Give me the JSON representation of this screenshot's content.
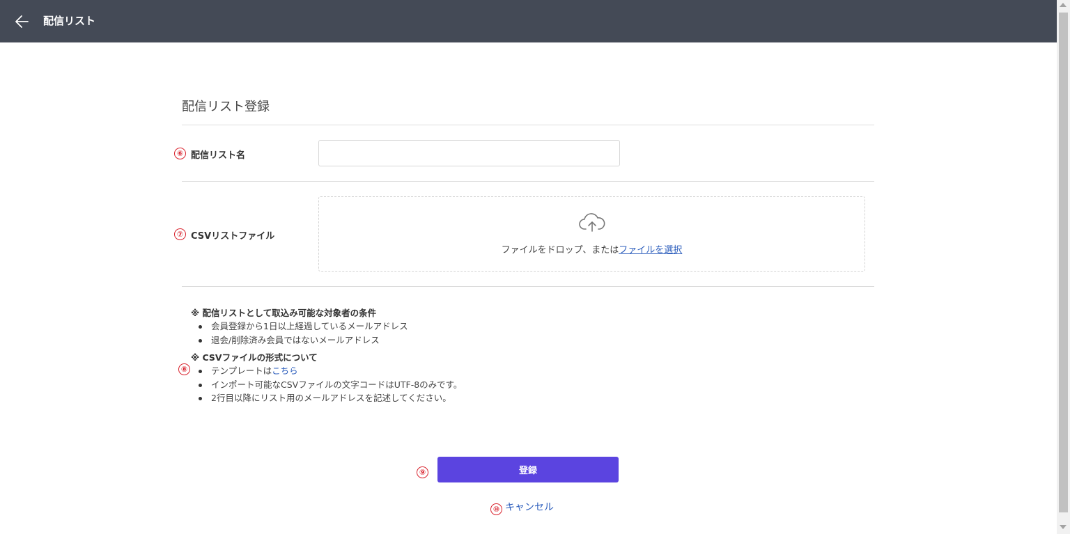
{
  "header": {
    "title": "配信リスト",
    "back_icon": "arrow-left-icon"
  },
  "form": {
    "section_title": "配信リスト登録",
    "list_name": {
      "marker": "⑥",
      "label": "配信リスト名",
      "value": "",
      "placeholder": ""
    },
    "csv_file": {
      "marker": "⑦",
      "label": "CSVリストファイル",
      "icon": "cloud-upload-icon",
      "drop_text": "ファイルをドロップ、または",
      "select_link": "ファイルを選択"
    }
  },
  "notes": {
    "marker": "⑧",
    "conditions_heading": "※ 配信リストとして取込み可能な対象者の条件",
    "conditions": [
      "会員登録から1日以上経過しているメールアドレス",
      "退会/削除済み会員ではないメールアドレス"
    ],
    "format_heading": "※ CSVファイルの形式について",
    "template_prefix": "テンプレートは",
    "template_link": "こちら",
    "format_items": [
      "インポート可能なCSVファイルの文字コードはUTF-8のみです。",
      "2行目以降にリスト用のメールアドレスを記述してください。"
    ]
  },
  "actions": {
    "submit_marker": "⑨",
    "submit_label": "登録",
    "cancel_marker": "⑩",
    "cancel_label": "キャンセル"
  },
  "colors": {
    "header_bg": "#444a56",
    "primary": "#5b44e0",
    "link": "#2e5fbd",
    "marker": "#d9232e"
  }
}
